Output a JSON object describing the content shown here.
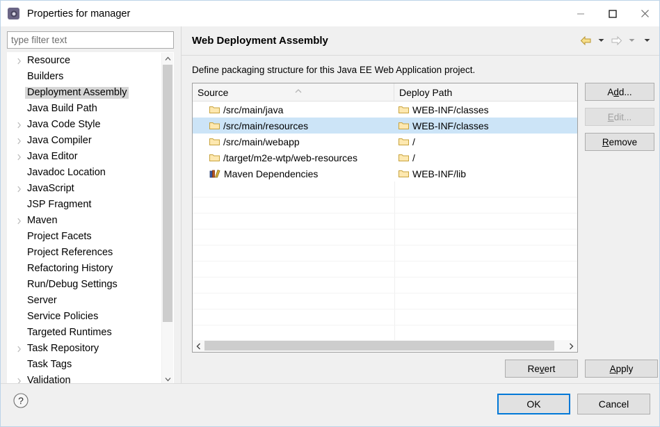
{
  "window": {
    "title": "Properties for manager",
    "icon": "eclipse-properties-icon",
    "controls": {
      "minimize": "minimize-icon",
      "maximize": "maximize-icon",
      "close": "close-icon"
    }
  },
  "filter": {
    "placeholder": "type filter text",
    "value": ""
  },
  "tree": {
    "items": [
      {
        "label": "Resource",
        "expandable": true,
        "selected": false
      },
      {
        "label": "Builders",
        "expandable": false,
        "selected": false
      },
      {
        "label": "Deployment Assembly",
        "expandable": false,
        "selected": true
      },
      {
        "label": "Java Build Path",
        "expandable": false,
        "selected": false
      },
      {
        "label": "Java Code Style",
        "expandable": true,
        "selected": false
      },
      {
        "label": "Java Compiler",
        "expandable": true,
        "selected": false
      },
      {
        "label": "Java Editor",
        "expandable": true,
        "selected": false
      },
      {
        "label": "Javadoc Location",
        "expandable": false,
        "selected": false
      },
      {
        "label": "JavaScript",
        "expandable": true,
        "selected": false
      },
      {
        "label": "JSP Fragment",
        "expandable": false,
        "selected": false
      },
      {
        "label": "Maven",
        "expandable": true,
        "selected": false
      },
      {
        "label": "Project Facets",
        "expandable": false,
        "selected": false
      },
      {
        "label": "Project References",
        "expandable": false,
        "selected": false
      },
      {
        "label": "Refactoring History",
        "expandable": false,
        "selected": false
      },
      {
        "label": "Run/Debug Settings",
        "expandable": false,
        "selected": false
      },
      {
        "label": "Server",
        "expandable": false,
        "selected": false
      },
      {
        "label": "Service Policies",
        "expandable": false,
        "selected": false
      },
      {
        "label": "Targeted Runtimes",
        "expandable": false,
        "selected": false
      },
      {
        "label": "Task Repository",
        "expandable": true,
        "selected": false
      },
      {
        "label": "Task Tags",
        "expandable": false,
        "selected": false
      },
      {
        "label": "Validation",
        "expandable": true,
        "selected": false
      }
    ]
  },
  "page": {
    "title": "Web Deployment Assembly",
    "description": "Define packaging structure for this Java EE Web Application project.",
    "nav": {
      "back": "back-arrow-icon",
      "back_menu": "chevron-down-icon",
      "forward": "forward-arrow-icon",
      "forward_menu": "chevron-down-icon",
      "view_menu": "chevron-down-icon"
    }
  },
  "table": {
    "columns": [
      "Source",
      "Deploy Path"
    ],
    "sort": {
      "column": "Source",
      "direction": "ascending",
      "icon": "sort-ascending-icon"
    },
    "rows": [
      {
        "source": "/src/main/java",
        "source_icon": "folder-icon",
        "deploy": "WEB-INF/classes",
        "deploy_icon": "folder-icon",
        "selected": false
      },
      {
        "source": "/src/main/resources",
        "source_icon": "folder-icon",
        "deploy": "WEB-INF/classes",
        "deploy_icon": "folder-icon",
        "selected": true
      },
      {
        "source": "/src/main/webapp",
        "source_icon": "folder-icon",
        "deploy": "/",
        "deploy_icon": "folder-icon",
        "selected": false
      },
      {
        "source": "/target/m2e-wtp/web-resources",
        "source_icon": "folder-icon",
        "deploy": "/",
        "deploy_icon": "folder-icon",
        "selected": false
      },
      {
        "source": "Maven Dependencies",
        "source_icon": "library-icon",
        "deploy": "WEB-INF/lib",
        "deploy_icon": "folder-icon",
        "selected": false
      }
    ],
    "empty_row_count": 10,
    "hscroll": {
      "left_arrow": "chevron-left-icon",
      "right_arrow": "chevron-right-icon"
    }
  },
  "side_buttons": [
    {
      "label": "Add...",
      "mnemonic": "d",
      "enabled": true,
      "name": "add-button"
    },
    {
      "label": "Edit...",
      "mnemonic": "E",
      "enabled": false,
      "name": "edit-button"
    },
    {
      "label": "Remove",
      "mnemonic": "R",
      "enabled": true,
      "name": "remove-button"
    }
  ],
  "page_buttons": [
    {
      "label": "Revert",
      "mnemonic": "v",
      "enabled": true,
      "name": "revert-button"
    },
    {
      "label": "Apply",
      "mnemonic": "A",
      "enabled": true,
      "name": "apply-button"
    }
  ],
  "dialog_buttons": [
    {
      "label": "OK",
      "default": true,
      "name": "ok-button"
    },
    {
      "label": "Cancel",
      "default": false,
      "name": "cancel-button"
    }
  ],
  "help": {
    "icon": "help-icon",
    "label": "?"
  },
  "colors": {
    "selection_blue": "#cce4f7",
    "selection_gray": "#d6d6d6",
    "accent_blue": "#0078d7",
    "folder_yellow": "#ffd87b",
    "dialog_bg": "#f0f0f0"
  }
}
